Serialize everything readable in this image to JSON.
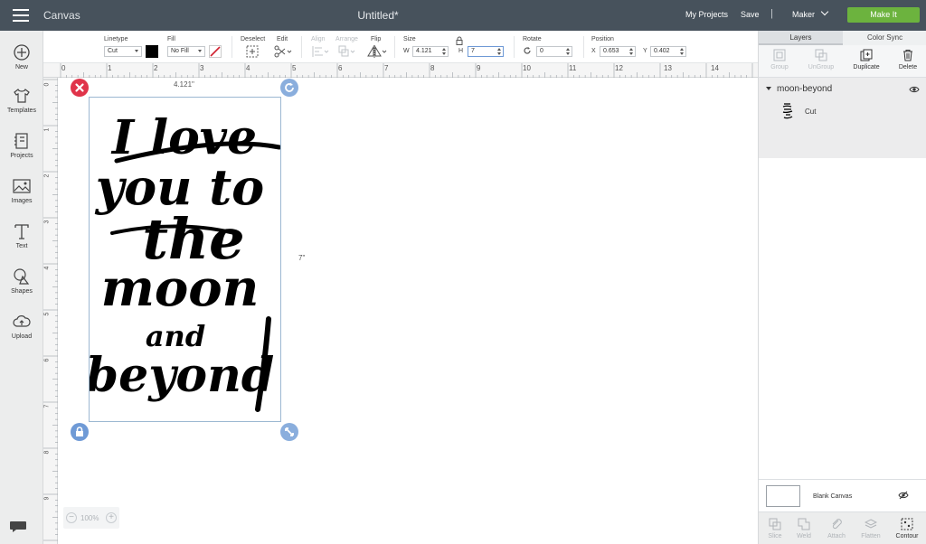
{
  "header": {
    "app_title": "Canvas",
    "document_title": "Untitled*",
    "my_projects": "My Projects",
    "save": "Save",
    "separator": "|",
    "machine": "Maker",
    "make_it": "Make It"
  },
  "sidebar": {
    "items": [
      {
        "label": "New",
        "icon": "plus-circle-icon"
      },
      {
        "label": "Templates",
        "icon": "tshirt-icon"
      },
      {
        "label": "Projects",
        "icon": "projects-icon"
      },
      {
        "label": "Images",
        "icon": "image-icon"
      },
      {
        "label": "Text",
        "icon": "text-icon"
      },
      {
        "label": "Shapes",
        "icon": "shapes-icon"
      },
      {
        "label": "Upload",
        "icon": "upload-cloud-icon"
      }
    ]
  },
  "toolbar": {
    "linetype_label": "Linetype",
    "linetype_value": "Cut",
    "fill_label": "Fill",
    "fill_value": "No Fill",
    "deselect_label": "Deselect",
    "edit_label": "Edit",
    "align_label": "Align",
    "arrange_label": "Arrange",
    "flip_label": "Flip",
    "size_label": "Size",
    "w_label": "W",
    "w_value": "4.121",
    "h_label": "H",
    "h_value": "7",
    "rotate_label": "Rotate",
    "rotate_value": "0",
    "position_label": "Position",
    "x_label": "X",
    "x_value": "0.653",
    "y_label": "Y",
    "y_value": "0.402",
    "linetype_color": "#000000"
  },
  "rulers": {
    "horizontal": [
      "0",
      "1",
      "2",
      "3",
      "4",
      "5",
      "6",
      "7",
      "8",
      "9",
      "10",
      "11",
      "12",
      "13",
      "14"
    ],
    "vertical": [
      "0",
      "1",
      "2",
      "3",
      "4",
      "5",
      "6",
      "7",
      "8",
      "9"
    ]
  },
  "canvas": {
    "width_dim": "4.121\"",
    "height_dim": "7\"",
    "zoom_value": "100%",
    "artwork_lines": [
      "I love",
      "you to",
      "the",
      "moon",
      "and",
      "beyond"
    ]
  },
  "right_panel": {
    "tab_layers": "Layers",
    "tab_color_sync": "Color Sync",
    "tools": [
      "Group",
      "UnGroup",
      "Duplicate",
      "Delete"
    ],
    "layer_name": "moon-beyond",
    "layer_operation": "Cut",
    "blank_canvas": "Blank Canvas",
    "bottom_tools": [
      "Slice",
      "Weld",
      "Attach",
      "Flatten",
      "Contour"
    ]
  },
  "colors": {
    "topbar": "#47525c",
    "make_it": "#6cb33e",
    "delete_handle": "#e0344a",
    "handle_blue": "#8aaedd"
  }
}
